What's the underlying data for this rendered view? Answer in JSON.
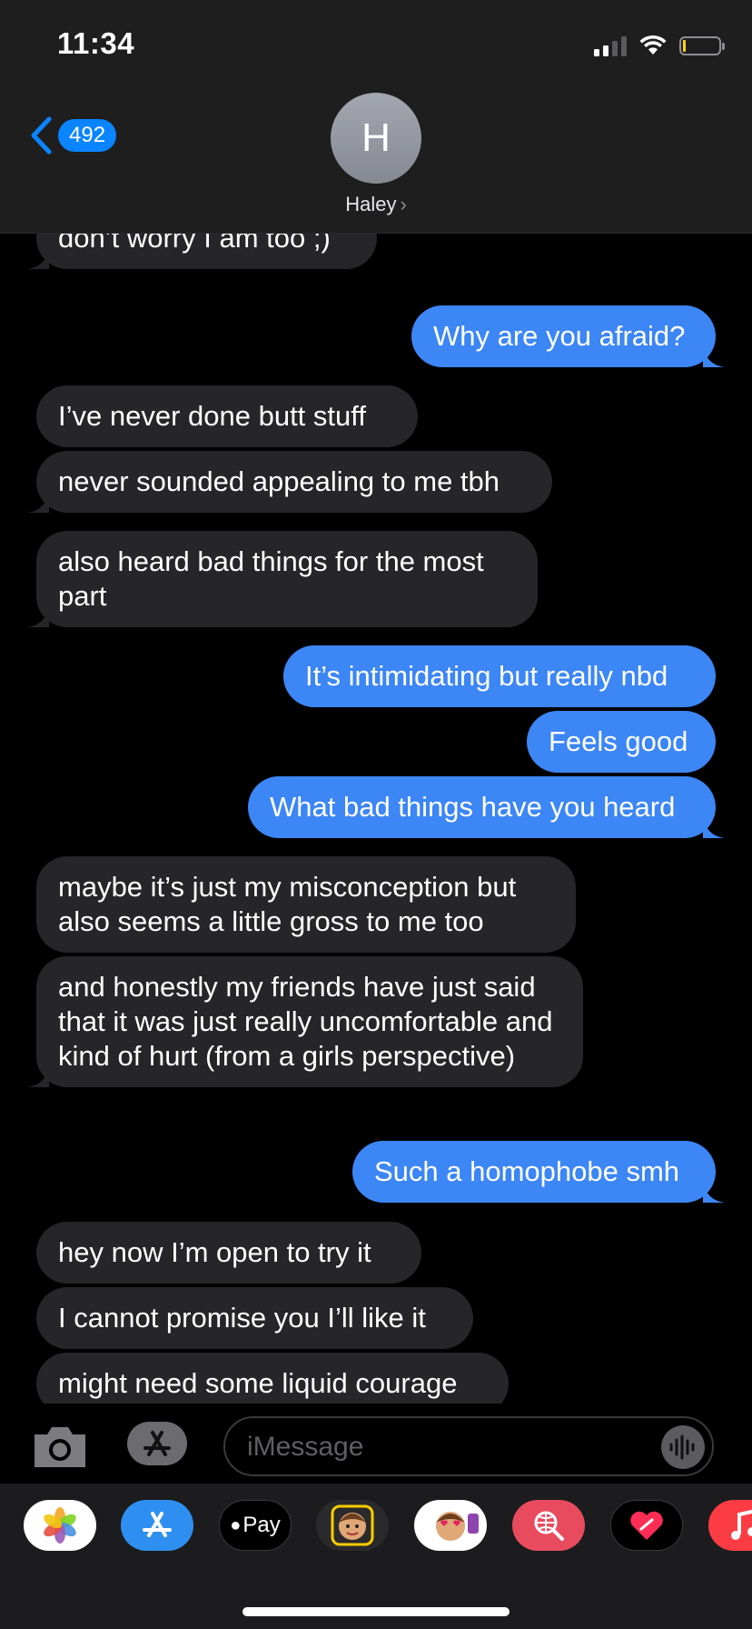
{
  "status_bar": {
    "time": "11:34"
  },
  "header": {
    "back_count": "492",
    "avatar_initial": "H",
    "contact_name": "Haley"
  },
  "messages": [
    {
      "from": "them",
      "text": "don’t worry I am too ;)"
    },
    {
      "from": "me",
      "text": "Why are you afraid?"
    },
    {
      "from": "them",
      "text": "I’ve never done butt stuff"
    },
    {
      "from": "them",
      "text": "never sounded appealing to me tbh"
    },
    {
      "from": "them",
      "text": "also heard bad things for the most part"
    },
    {
      "from": "me",
      "text": "It’s intimidating but really nbd"
    },
    {
      "from": "me",
      "text": "Feels good"
    },
    {
      "from": "me",
      "text": "What bad things have you heard"
    },
    {
      "from": "them",
      "text": "maybe it’s just my misconception but also seems a little gross to me too"
    },
    {
      "from": "them",
      "text": "and honestly my friends have just said that it was just really uncomfortable and kind of hurt (from a girls perspective)"
    },
    {
      "from": "me",
      "text": "Such a homophobe smh"
    },
    {
      "from": "them",
      "text": "hey now I’m open to try it"
    },
    {
      "from": "them",
      "text": "I cannot promise you I’ll like it"
    },
    {
      "from": "them",
      "text": "might need some liquid courage"
    }
  ],
  "compose": {
    "placeholder": "iMessage"
  },
  "drawer": {
    "apple_pay_label": "Pay",
    "apps": [
      "photos-icon",
      "app-store-icon",
      "apple-pay-icon",
      "memoji-icon",
      "animoji-icon",
      "image-search-icon",
      "digital-touch-icon",
      "music-icon"
    ]
  },
  "colors": {
    "sent_bubble": "#3c86f5",
    "received_bubble": "#262628",
    "accent": "#0a84ff",
    "background": "#000000"
  }
}
